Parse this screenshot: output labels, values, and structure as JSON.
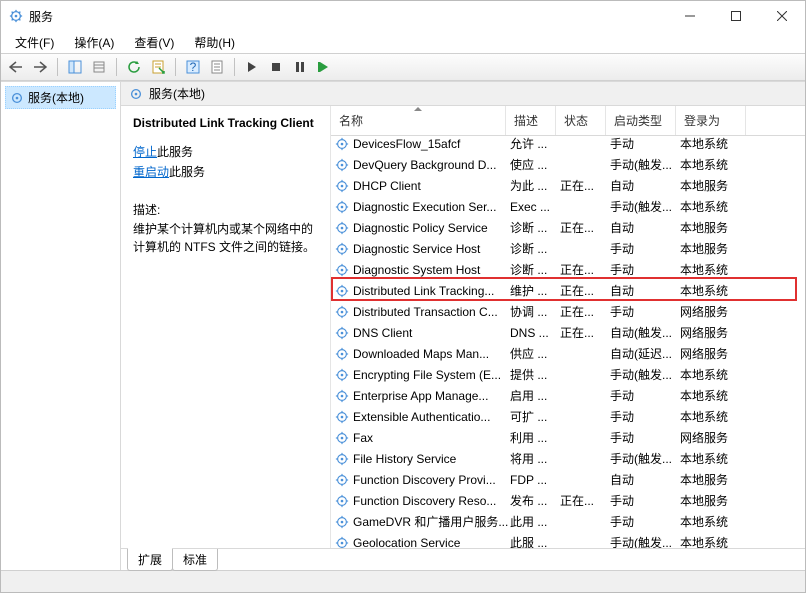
{
  "window": {
    "title": "服务"
  },
  "menu": {
    "file": "文件(F)",
    "action": "操作(A)",
    "view": "查看(V)",
    "help": "帮助(H)"
  },
  "tree": {
    "root": "服务(本地)"
  },
  "panel": {
    "title": "服务(本地)"
  },
  "detail": {
    "selected_name": "Distributed Link Tracking Client",
    "stop_link": "停止",
    "stop_suffix": "此服务",
    "restart_link": "重启动",
    "restart_suffix": "此服务",
    "desc_label": "描述:",
    "desc_text": "维护某个计算机内或某个网络中的计算机的 NTFS 文件之间的链接。"
  },
  "columns": {
    "name": "名称",
    "desc": "描述",
    "status": "状态",
    "startup": "启动类型",
    "logon": "登录为"
  },
  "tabs": {
    "extended": "扩展",
    "standard": "标准"
  },
  "highlight_index": 7,
  "services": [
    {
      "name": "DevicesFlow_15afcf",
      "desc": "允许 ...",
      "status": "",
      "startup": "手动",
      "logon": "本地系统"
    },
    {
      "name": "DevQuery Background D...",
      "desc": "使应 ...",
      "status": "",
      "startup": "手动(触发...",
      "logon": "本地系统"
    },
    {
      "name": "DHCP Client",
      "desc": "为此 ...",
      "status": "正在...",
      "startup": "自动",
      "logon": "本地服务"
    },
    {
      "name": "Diagnostic Execution Ser...",
      "desc": "Exec ...",
      "status": "",
      "startup": "手动(触发...",
      "logon": "本地系统"
    },
    {
      "name": "Diagnostic Policy Service",
      "desc": "诊断 ...",
      "status": "正在...",
      "startup": "自动",
      "logon": "本地服务"
    },
    {
      "name": "Diagnostic Service Host",
      "desc": "诊断 ...",
      "status": "",
      "startup": "手动",
      "logon": "本地服务"
    },
    {
      "name": "Diagnostic System Host",
      "desc": "诊断 ...",
      "status": "正在...",
      "startup": "手动",
      "logon": "本地系统"
    },
    {
      "name": "Distributed Link Tracking...",
      "desc": "维护 ...",
      "status": "正在...",
      "startup": "自动",
      "logon": "本地系统"
    },
    {
      "name": "Distributed Transaction C...",
      "desc": "协调 ...",
      "status": "正在...",
      "startup": "手动",
      "logon": "网络服务"
    },
    {
      "name": "DNS Client",
      "desc": "DNS ...",
      "status": "正在...",
      "startup": "自动(触发...",
      "logon": "网络服务"
    },
    {
      "name": "Downloaded Maps Man...",
      "desc": "供应 ...",
      "status": "",
      "startup": "自动(延迟...",
      "logon": "网络服务"
    },
    {
      "name": "Encrypting File System (E...",
      "desc": "提供 ...",
      "status": "",
      "startup": "手动(触发...",
      "logon": "本地系统"
    },
    {
      "name": "Enterprise App Manage...",
      "desc": "启用 ...",
      "status": "",
      "startup": "手动",
      "logon": "本地系统"
    },
    {
      "name": "Extensible Authenticatio...",
      "desc": "可扩 ...",
      "status": "",
      "startup": "手动",
      "logon": "本地系统"
    },
    {
      "name": "Fax",
      "desc": "利用 ...",
      "status": "",
      "startup": "手动",
      "logon": "网络服务"
    },
    {
      "name": "File History Service",
      "desc": "将用 ...",
      "status": "",
      "startup": "手动(触发...",
      "logon": "本地系统"
    },
    {
      "name": "Function Discovery Provi...",
      "desc": "FDP ...",
      "status": "",
      "startup": "自动",
      "logon": "本地服务"
    },
    {
      "name": "Function Discovery Reso...",
      "desc": "发布 ...",
      "status": "正在...",
      "startup": "手动",
      "logon": "本地服务"
    },
    {
      "name": "GameDVR 和广播用户服务...",
      "desc": "此用 ...",
      "status": "",
      "startup": "手动",
      "logon": "本地系统"
    },
    {
      "name": "Geolocation Service",
      "desc": "此服 ...",
      "status": "",
      "startup": "手动(触发...",
      "logon": "本地系统"
    }
  ]
}
